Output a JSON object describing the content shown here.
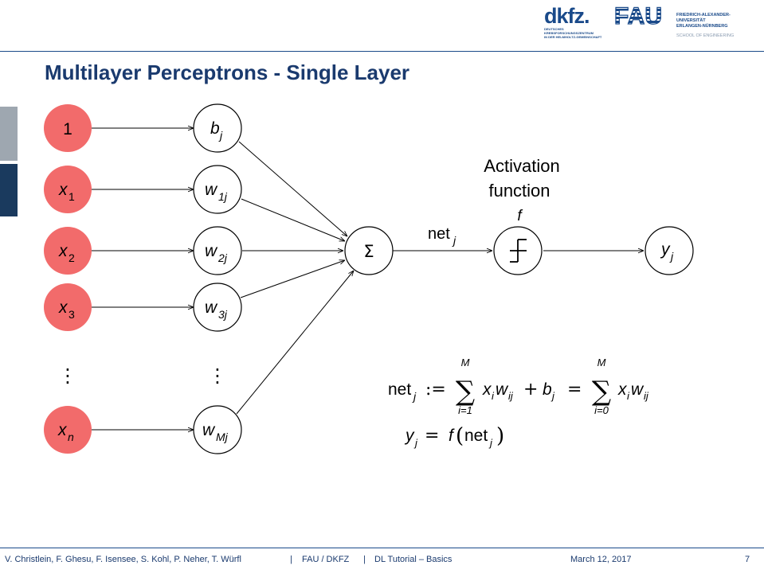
{
  "header": {
    "dkfz_logo_text": "dkfz.",
    "dkfz_subtitle": [
      "DEUTSCHES",
      "KREBSFORSCHUNGSZENTRUM",
      "IN DER HELMHOLTZ-GEMEINSCHAFT"
    ],
    "fau_logo_text": "FAU",
    "fau_name": [
      "FRIEDRICH-ALEXANDER-",
      "UNIVERSITÄT",
      "ERLANGEN-NÜRNBERG"
    ],
    "fau_school": "SCHOOL OF ENGINEERING"
  },
  "slide": {
    "title": "Multilayer Perceptrons - Single Layer"
  },
  "diagram": {
    "inputs": [
      {
        "main": "1",
        "sub": ""
      },
      {
        "main": "x",
        "sub": "1"
      },
      {
        "main": "x",
        "sub": "2"
      },
      {
        "main": "x",
        "sub": "3"
      },
      {
        "main": "⋮",
        "sub": ""
      },
      {
        "main": "x",
        "sub": "n"
      }
    ],
    "weights": [
      {
        "main": "b",
        "sub": "j"
      },
      {
        "main": "w",
        "sub": "1j"
      },
      {
        "main": "w",
        "sub": "2j"
      },
      {
        "main": "w",
        "sub": "3j"
      },
      {
        "main": "⋮",
        "sub": ""
      },
      {
        "main": "w",
        "sub": "Mj"
      }
    ],
    "sum_symbol": "Σ",
    "net_label": {
      "main": "net",
      "sub": "j"
    },
    "activation_label": [
      "Activation",
      "function"
    ],
    "activation_f": "f",
    "output": {
      "main": "y",
      "sub": "j"
    },
    "colors": {
      "input_fill": "#f26b6b",
      "node_stroke": "#000000"
    }
  },
  "equations": {
    "eq1": {
      "lhs": "net",
      "lhs_sub": "j",
      "assign": ":=",
      "sum1_upper": "M",
      "sum1_lower": "i=1",
      "term1": "x",
      "term1_sub": "i",
      "term1b": "w",
      "term1b_sub": "ij",
      "plus": "+",
      "bias": "b",
      "bias_sub": "j",
      "eq": "=",
      "sum2_upper": "M",
      "sum2_lower": "i=0",
      "term2": "x",
      "term2_sub": "i",
      "term2b": "w",
      "term2b_sub": "ij"
    },
    "eq2": {
      "lhs": "y",
      "lhs_sub": "j",
      "eq": "=",
      "f": "f",
      "paren_open": "(",
      "arg": "net",
      "arg_sub": "j",
      "paren_close": ")"
    }
  },
  "footer": {
    "authors": "V. Christlein, F. Ghesu, F. Isensee, S. Kohl, P. Neher, T. Würfl",
    "sep1": "|",
    "org": "FAU / DKFZ",
    "sep2": "|",
    "course": "DL Tutorial – Basics",
    "date": "March 12, 2017",
    "page": "7"
  }
}
